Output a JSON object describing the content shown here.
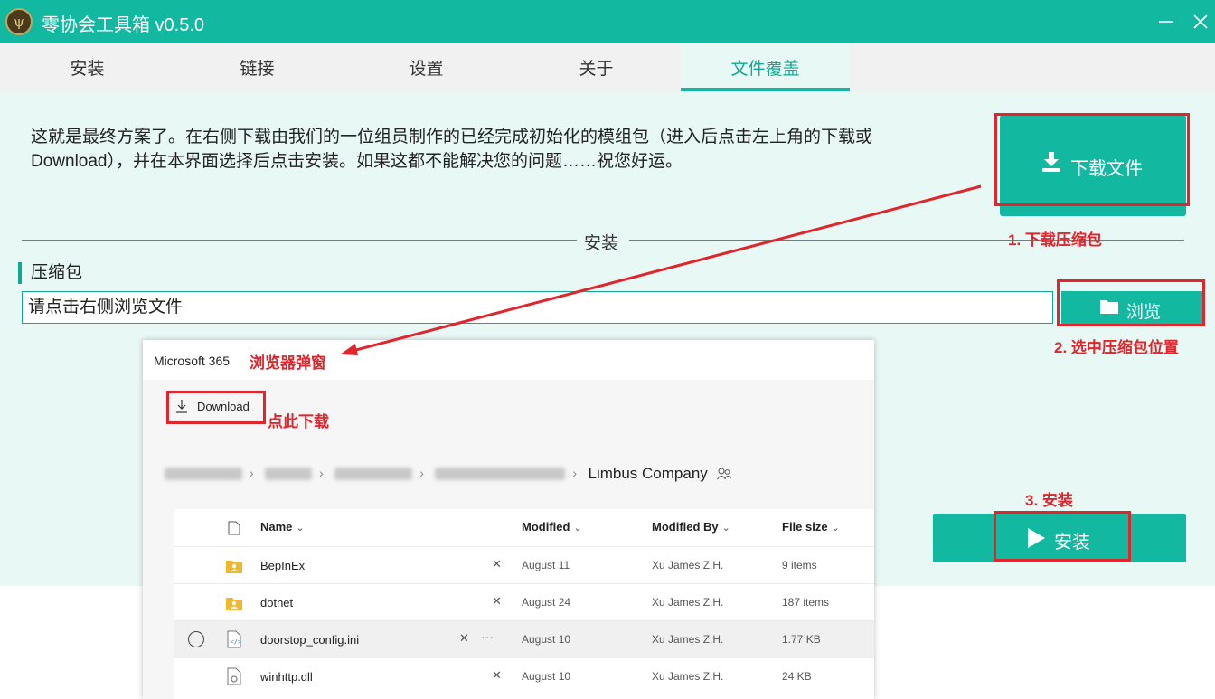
{
  "window": {
    "title": "零协会工具箱 v0.5.0",
    "icon": "app-logo-icon"
  },
  "tabs": [
    {
      "label": "安装"
    },
    {
      "label": "链接"
    },
    {
      "label": "设置"
    },
    {
      "label": "关于"
    },
    {
      "label": "文件覆盖",
      "active": true
    }
  ],
  "main": {
    "description": "这就是最终方案了。在右侧下载由我们的一位组员制作的已经完成初始化的模组包（进入后点击左上角的下载或Download），并在本界面选择后点击安装。如果这都不能解决您的问题……祝您好运。",
    "download_button": "下载文件",
    "section_title": "安装",
    "field_label": "压缩包",
    "file_input_placeholder": "请点击右侧浏览文件",
    "browse_button": "浏览",
    "install_button": "安装"
  },
  "annotations": {
    "step1": "1. 下载压缩包",
    "step2": "2. 选中压缩包位置",
    "step3": "3. 安装",
    "popup_note": "浏览器弹窗",
    "download_note": "点此下载"
  },
  "popup": {
    "brand": "Microsoft 365",
    "download_label": "Download",
    "breadcrumb_current": "Limbus Company",
    "columns": [
      "Name",
      "Modified",
      "Modified By",
      "File size"
    ],
    "rows": [
      {
        "name": "BepInEx",
        "modified": "August 11",
        "modified_by": "Xu James Z.H.",
        "size": "9 items",
        "type": "folder"
      },
      {
        "name": "dotnet",
        "modified": "August 24",
        "modified_by": "Xu James Z.H.",
        "size": "187 items",
        "type": "folder"
      },
      {
        "name": "doorstop_config.ini",
        "modified": "August 10",
        "modified_by": "Xu James Z.H.",
        "size": "1.77 KB",
        "type": "file"
      },
      {
        "name": "winhttp.dll",
        "modified": "August 10",
        "modified_by": "Xu James Z.H.",
        "size": "24 KB",
        "type": "file"
      }
    ]
  },
  "colors": {
    "accent": "#13b8a1",
    "annotation_red": "#e0262d",
    "panel_bg": "#e8f8f5"
  }
}
